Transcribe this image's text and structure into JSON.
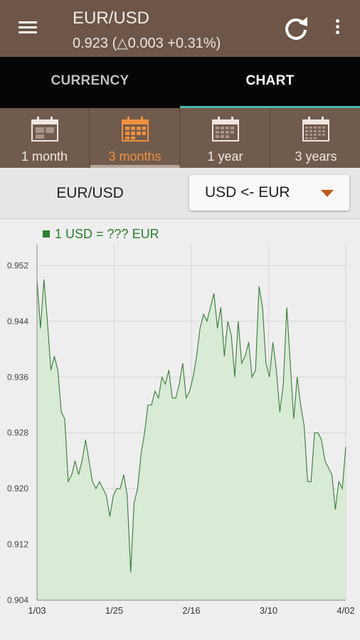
{
  "header": {
    "title": "EUR/USD",
    "subtitle": "0.923 (△0.003 +0.31%)"
  },
  "tabs": [
    {
      "label": "CURRENCY",
      "active": false
    },
    {
      "label": "CHART",
      "active": true
    }
  ],
  "ranges": [
    {
      "label": "1 month",
      "active": false
    },
    {
      "label": "3 months",
      "active": true
    },
    {
      "label": "1 year",
      "active": false
    },
    {
      "label": "3 years",
      "active": false
    }
  ],
  "selector": {
    "pair": "EUR/USD",
    "direction": "USD <- EUR"
  },
  "colors": {
    "toolbar": "#6d5648",
    "accent": "#f09040",
    "line": "#3b7a3b",
    "fill": "#d9ead6",
    "indicator": "#4db6ac"
  },
  "chart_data": {
    "type": "area",
    "legend": "1 USD = ??? EUR",
    "ylim": [
      0.904,
      0.955
    ],
    "yticks": [
      "0.952",
      "0.944",
      "0.936",
      "0.928",
      "0.920",
      "0.912",
      "0.904"
    ],
    "xtick_labels": [
      "1/03",
      "1/25",
      "2/16",
      "3/10",
      "4/02"
    ],
    "grid": true,
    "values": [
      0.95,
      0.943,
      0.95,
      0.944,
      0.937,
      0.939,
      0.937,
      0.931,
      0.93,
      0.921,
      0.922,
      0.924,
      0.922,
      0.924,
      0.927,
      0.924,
      0.921,
      0.92,
      0.921,
      0.92,
      0.919,
      0.916,
      0.919,
      0.92,
      0.92,
      0.922,
      0.919,
      0.908,
      0.918,
      0.92,
      0.925,
      0.928,
      0.932,
      0.932,
      0.934,
      0.933,
      0.936,
      0.935,
      0.937,
      0.933,
      0.933,
      0.935,
      0.938,
      0.933,
      0.934,
      0.936,
      0.939,
      0.943,
      0.945,
      0.944,
      0.946,
      0.948,
      0.943,
      0.946,
      0.939,
      0.944,
      0.942,
      0.936,
      0.944,
      0.938,
      0.939,
      0.941,
      0.936,
      0.937,
      0.949,
      0.946,
      0.938,
      0.936,
      0.941,
      0.937,
      0.931,
      0.935,
      0.946,
      0.938,
      0.93,
      0.936,
      0.932,
      0.929,
      0.921,
      0.921,
      0.928,
      0.928,
      0.927,
      0.924,
      0.923,
      0.922,
      0.917,
      0.921,
      0.92,
      0.926
    ]
  }
}
